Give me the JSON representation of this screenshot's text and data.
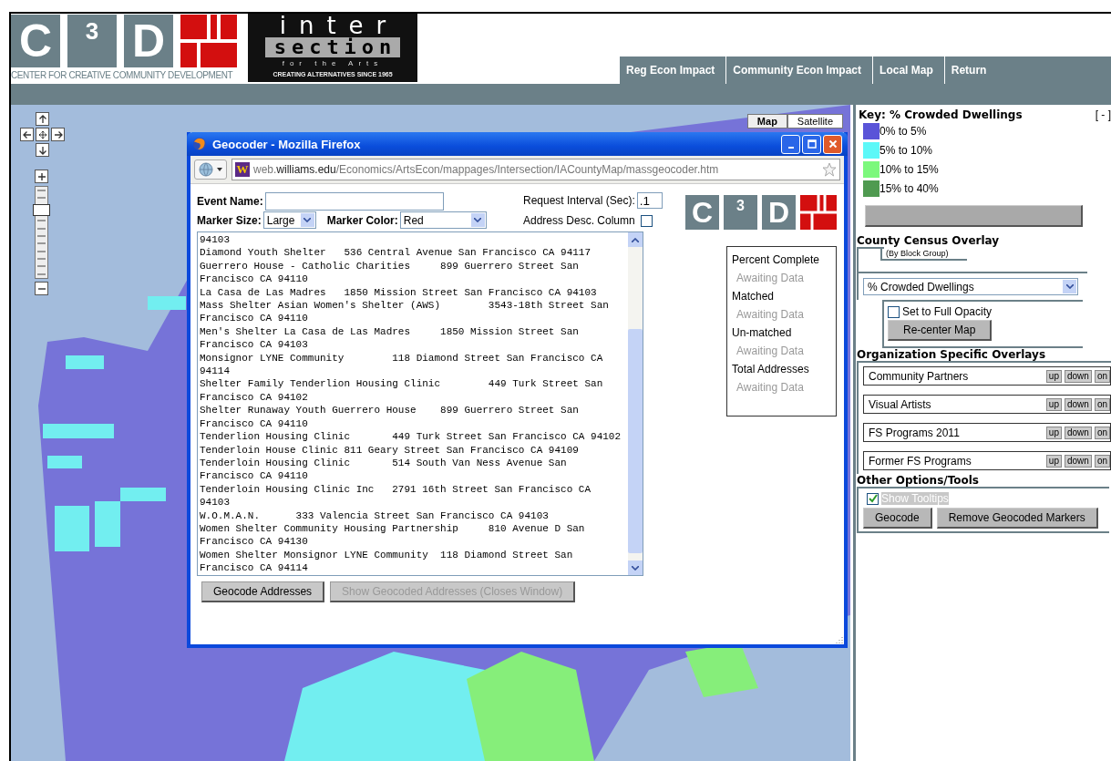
{
  "header": {
    "c3d_logo": {
      "letters": [
        "C",
        "3",
        "D"
      ],
      "tagline": "CENTER FOR CREATIVE COMMUNITY DEVELOPMENT"
    },
    "intersection_logo": {
      "line_1": "inter",
      "line_2": "section",
      "line_3": "for the Arts",
      "tagline": "CREATING ALTERNATIVES SINCE 1965"
    }
  },
  "nav": [
    "Reg Econ Impact",
    "Community Econ Impact",
    "Local Map",
    "Return"
  ],
  "map": {
    "type_buttons": [
      {
        "label": "Map",
        "selected": true
      },
      {
        "label": "Satellite",
        "selected": false
      }
    ],
    "zoom_slider": {
      "level": 0.78
    }
  },
  "geocoder_window": {
    "title": "Geocoder - Mozilla Firefox",
    "favicon_letter": "W",
    "url_prefix": "web.",
    "url_host_bold": "williams.edu",
    "url_path": "/Economics/ArtsEcon/mappages/Intersection/IACountyMap/massgeocoder.htm",
    "event_name": {
      "label": "Event Name:"
    },
    "marker_size": {
      "label": "Marker Size:",
      "value": "Large"
    },
    "marker_color": {
      "label": "Marker Color:",
      "value": "Red"
    },
    "request_interval": {
      "label": "Request Interval (Sec):",
      "value": ".1"
    },
    "address_desc_column": {
      "label": "Address Desc. Column",
      "checked": false
    },
    "logo_letters": [
      "C",
      "3",
      "D"
    ],
    "address_lines": [
      "94103",
      "Diamond Youth Shelter   536 Central Avenue San Francisco CA 94117",
      "Guerrero House - Catholic Charities     899 Guerrero Street San",
      "Francisco CA 94110",
      "La Casa de Las Madres   1850 Mission Street San Francisco CA 94103",
      "Mass Shelter Asian Women's Shelter (AWS)        3543-18th Street San",
      "Francisco CA 94110",
      "Men's Shelter La Casa de Las Madres     1850 Mission Street San",
      "Francisco CA 94103",
      "Monsignor LYNE Community        118 Diamond Street San Francisco CA",
      "94114",
      "Shelter Family Tenderlion Housing Clinic        449 Turk Street San",
      "Francisco CA 94102",
      "Shelter Runaway Youth Guerrero House    899 Guerrero Street San",
      "Francisco CA 94110",
      "Tenderlion Housing Clinic       449 Turk Street San Francisco CA 94102",
      "Tenderloin House Clinic 811 Geary Street San Francisco CA 94109",
      "Tenderloin Housing Clinic       514 South Van Ness Avenue San",
      "Francisco CA 94110",
      "Tenderloin Housing Clinic Inc   2791 16th Street San Francisco CA",
      "94103",
      "W.O.M.A.N.      333 Valencia Street San Francisco CA 94103",
      "Women Shelter Community Housing Partnership     810 Avenue D San",
      "Francisco CA 94130",
      "Women Shelter Monsignor LYNE Community  118 Diamond Street San",
      "Francisco CA 94114"
    ],
    "status": [
      {
        "label": "Percent Complete",
        "value": "Awaiting Data"
      },
      {
        "label": "Matched",
        "value": "Awaiting Data"
      },
      {
        "label": "Un-matched",
        "value": "Awaiting Data"
      },
      {
        "label": "Total Addresses",
        "value": "Awaiting Data"
      }
    ],
    "buttons": [
      {
        "label": "Geocode Addresses",
        "disabled": false
      },
      {
        "label": "Show Geocoded Addresses (Closes Window)",
        "disabled": true
      }
    ]
  },
  "side_panel": {
    "key_title": "Key: % Crowded Dwellings",
    "collapse": "[ - ]",
    "legend": [
      {
        "label": "0% to 5%",
        "color": "#5a54d8"
      },
      {
        "label": "5% to 10%",
        "color": "#5cf8f8"
      },
      {
        "label": "10% to 15%",
        "color": "#7cf87c"
      },
      {
        "label": "15% to 40%",
        "color": "#4f9a50"
      }
    ],
    "census_title": "County Census Overlay",
    "census_note": "(By Block Group)",
    "overlay_select": "% Crowded Dwellings",
    "full_opacity": {
      "label": "Set to Full Opacity",
      "checked": false
    },
    "recenter_button": "Re-center Map",
    "org_title": "Organization Specific Overlays",
    "org_overlays": [
      {
        "name": "Community Partners",
        "buttons": [
          "up",
          "down",
          "on"
        ]
      },
      {
        "name": "Visual Artists",
        "buttons": [
          "up",
          "down",
          "on"
        ]
      },
      {
        "name": "FS Programs 2011",
        "buttons": [
          "up",
          "down",
          "on"
        ]
      },
      {
        "name": "Former FS Programs",
        "buttons": [
          "up",
          "down",
          "on"
        ]
      }
    ],
    "tools_title": "Other Options/Tools",
    "show_tooltips": {
      "label": "Show Tooltips",
      "checked": true
    },
    "tool_buttons": [
      "Geocode",
      "Remove Geocoded Markers"
    ]
  }
}
